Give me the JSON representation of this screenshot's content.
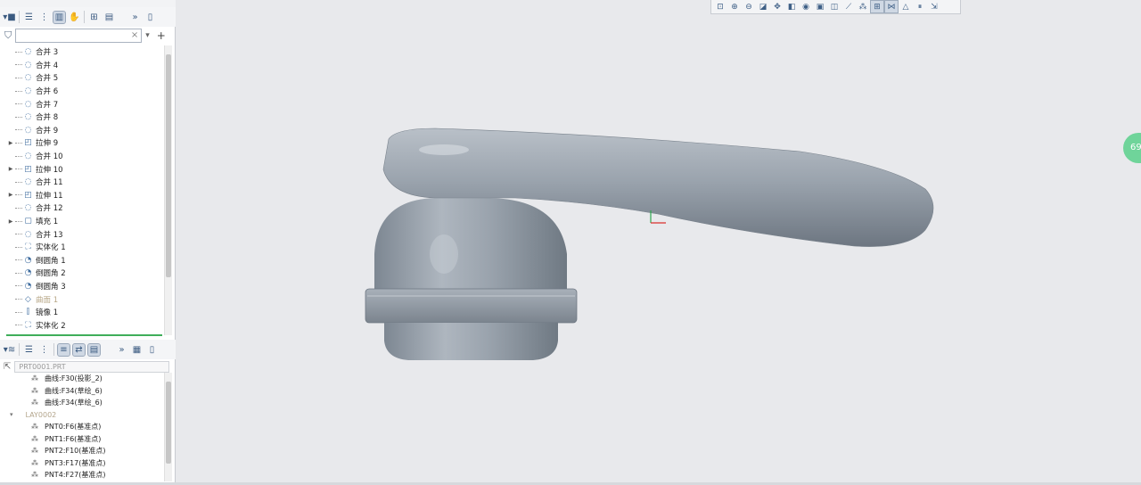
{
  "model_tree": {
    "items": [
      {
        "label": "合并 3",
        "icon": "merge-icon",
        "expand": false,
        "faded": false
      },
      {
        "label": "合并 4",
        "icon": "merge-icon",
        "expand": false,
        "faded": false
      },
      {
        "label": "合并 5",
        "icon": "merge-icon",
        "expand": false,
        "faded": false
      },
      {
        "label": "合并 6",
        "icon": "merge-icon",
        "expand": false,
        "faded": false
      },
      {
        "label": "合并 7",
        "icon": "merge-icon",
        "expand": false,
        "faded": false
      },
      {
        "label": "合并 8",
        "icon": "merge-icon",
        "expand": false,
        "faded": false
      },
      {
        "label": "合并 9",
        "icon": "merge-icon",
        "expand": false,
        "faded": false
      },
      {
        "label": "拉伸 9",
        "icon": "extrude-icon",
        "expand": true,
        "faded": false
      },
      {
        "label": "合并 10",
        "icon": "merge-icon",
        "expand": false,
        "faded": false
      },
      {
        "label": "拉伸 10",
        "icon": "extrude-icon",
        "expand": true,
        "faded": false
      },
      {
        "label": "合并 11",
        "icon": "merge-icon",
        "expand": false,
        "faded": false
      },
      {
        "label": "拉伸 11",
        "icon": "extrude-icon",
        "expand": true,
        "faded": false
      },
      {
        "label": "合并 12",
        "icon": "merge-icon",
        "expand": false,
        "faded": false
      },
      {
        "label": "填充 1",
        "icon": "fill-icon",
        "expand": true,
        "faded": false
      },
      {
        "label": "合并 13",
        "icon": "merge-icon",
        "expand": false,
        "faded": false
      },
      {
        "label": "实体化 1",
        "icon": "solidify-icon",
        "expand": false,
        "faded": false
      },
      {
        "label": "倒圆角 1",
        "icon": "round-icon",
        "expand": false,
        "faded": false
      },
      {
        "label": "倒圆角 2",
        "icon": "round-icon",
        "expand": false,
        "faded": false
      },
      {
        "label": "倒圆角 3",
        "icon": "round-icon",
        "expand": false,
        "faded": false
      },
      {
        "label": "曲面 1",
        "icon": "surface-icon",
        "expand": false,
        "faded": true
      },
      {
        "label": "镜像 1",
        "icon": "mirror-icon",
        "expand": false,
        "faded": false
      },
      {
        "label": "实体化 2",
        "icon": "solidify-icon",
        "expand": false,
        "faded": false
      }
    ]
  },
  "filter": {
    "clear_glyph": "×",
    "dropdown_glyph": "▾",
    "add_glyph": "+"
  },
  "layer_tree": {
    "path": "PRT0001.PRT",
    "items": [
      {
        "label": "曲线:F30(投影_2)",
        "faded": false
      },
      {
        "label": "曲线:F34(草绘_6)",
        "faded": false
      },
      {
        "label": "曲线:F34(草绘_6)",
        "faded": false
      },
      {
        "label": "LAY0002",
        "faded": true,
        "group": true
      },
      {
        "label": "PNT0:F6(基准点)",
        "faded": false
      },
      {
        "label": "PNT1:F6(基准点)",
        "faded": false
      },
      {
        "label": "PNT2:F10(基准点)",
        "faded": false
      },
      {
        "label": "PNT3:F17(基准点)",
        "faded": false
      },
      {
        "label": "PNT4:F27(基准点)",
        "faded": false
      }
    ]
  },
  "viewport": {
    "badge": "69",
    "model_color": "#9aa3ad"
  }
}
